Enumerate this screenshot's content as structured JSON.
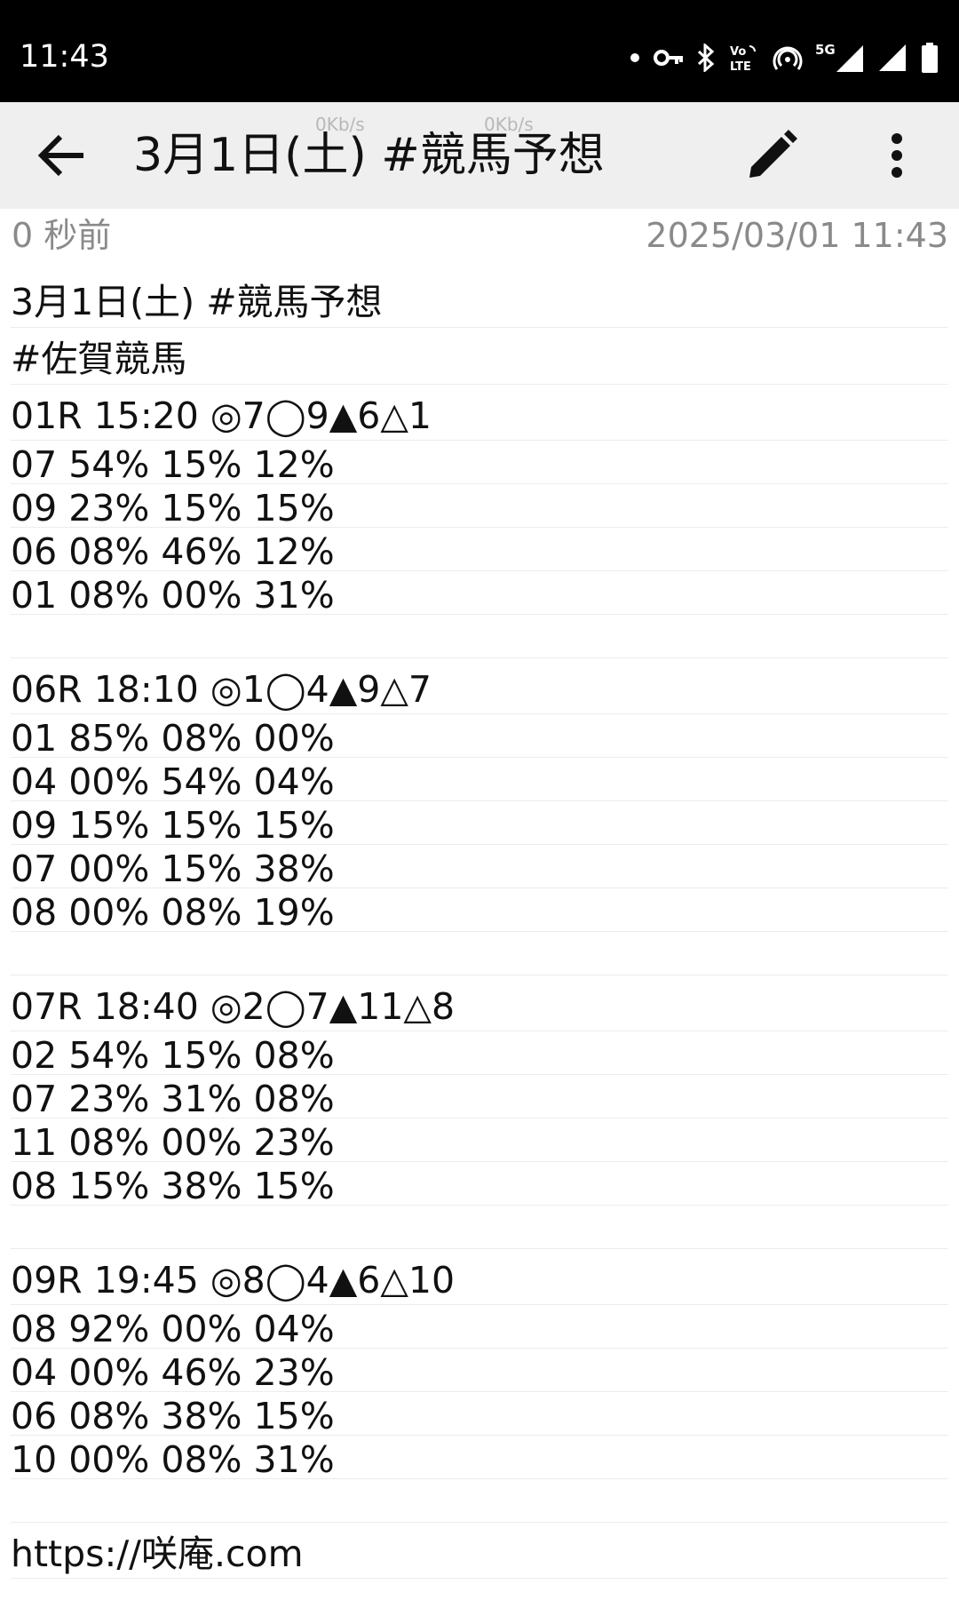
{
  "status_bar": {
    "time": "11:43",
    "icons": [
      "dot-icon",
      "vpn-key-icon",
      "bluetooth-icon",
      "volte-icon",
      "hotspot-icon",
      "5g-signal-icon",
      "signal-icon",
      "battery-icon"
    ],
    "network_label": "5G",
    "volte_label_top": "Vo",
    "volte_label_bottom": "LTE"
  },
  "app_bar": {
    "title": "3月1日(土) #競馬予想",
    "net_speed_1": "0Kb/s",
    "net_speed_2": "0Kb/s",
    "back_icon": "arrow-back-icon",
    "edit_icon": "pencil-icon",
    "more_icon": "more-vert-icon"
  },
  "meta": {
    "relative_time": "0 秒前",
    "timestamp": "2025/03/01 11:43"
  },
  "note": {
    "title_line": "3月1日(土) #競馬予想",
    "tag_line": "#佐賀競馬",
    "races": [
      {
        "header": "01R 15:20 ◎7◯9▲6△1",
        "rows": [
          "07 54% 15% 12%",
          "09 23% 15% 15%",
          "06 08% 46% 12%",
          "01 08% 00% 31%"
        ]
      },
      {
        "header": "06R 18:10 ◎1◯4▲9△7",
        "rows": [
          "01 85% 08% 00%",
          "04 00% 54% 04%",
          "09 15% 15% 15%",
          "07 00% 15% 38%",
          "08 00% 08% 19%"
        ]
      },
      {
        "header": "07R 18:40 ◎2◯7▲11△8",
        "rows": [
          "02 54% 15% 08%",
          "07 23% 31% 08%",
          "11 08% 00% 23%",
          "08 15% 38% 15%"
        ]
      },
      {
        "header": "09R 19:45 ◎8◯4▲6△10",
        "rows": [
          "08 92% 00% 04%",
          "04 00% 46% 23%",
          "06 08% 38% 15%",
          "10 00% 08% 31%"
        ]
      }
    ],
    "footer_url": "https://咲庵.com"
  }
}
